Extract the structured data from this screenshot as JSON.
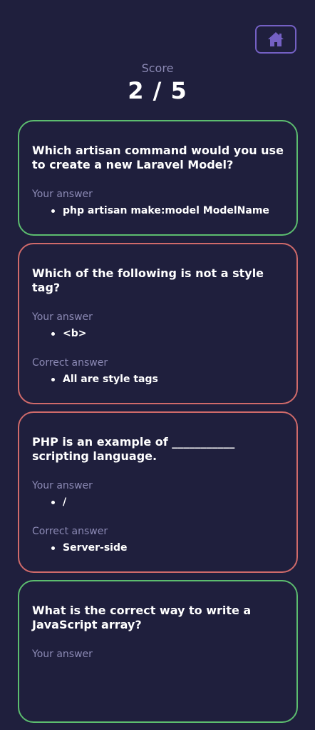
{
  "header": {
    "home_icon": "home-icon",
    "score_label": "Score",
    "score_value": "2 / 5"
  },
  "labels": {
    "your_answer": "Your answer",
    "correct_answer": "Correct answer"
  },
  "colors": {
    "background": "#1f1f3d",
    "correct_border": "#5cbd6f",
    "wrong_border": "#d06a6a",
    "accent": "#7460c4",
    "muted_text": "#8b89b4"
  },
  "results": [
    {
      "status": "correct",
      "question": "Which artisan command would you use to create a new Laravel Model?",
      "your_answer": "php artisan make:model ModelName"
    },
    {
      "status": "wrong",
      "question": "Which of the following is not a style tag?",
      "your_answer": "<b>",
      "correct_answer": "All are style tags"
    },
    {
      "status": "wrong",
      "question": "PHP is an example of ___________ scripting language.",
      "your_answer": "/",
      "correct_answer": "Server-side"
    },
    {
      "status": "correct",
      "question": "What is the correct way to write a JavaScript array?",
      "your_answer": ""
    }
  ]
}
